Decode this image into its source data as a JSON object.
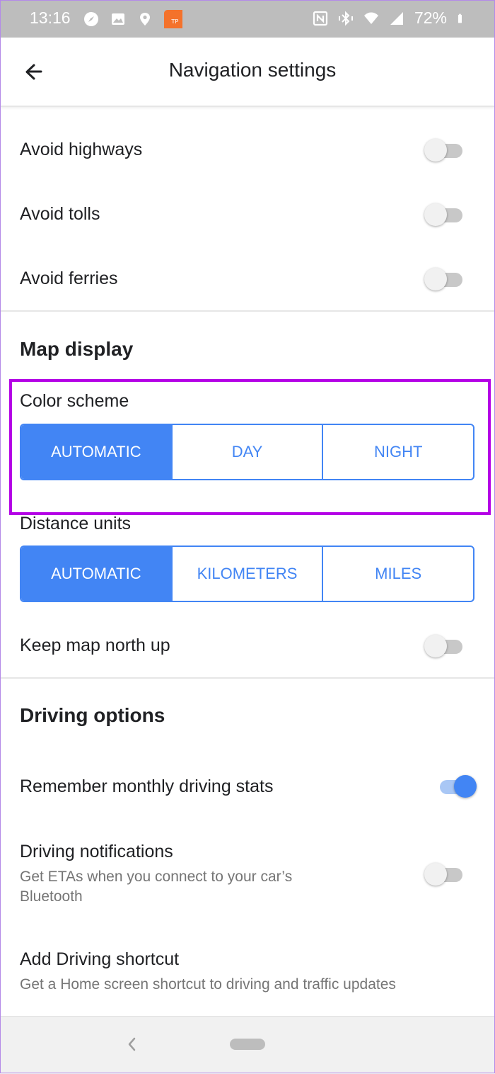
{
  "status_bar": {
    "time": "13:16",
    "battery": "72%",
    "left_icons": [
      "compass-icon",
      "image-icon",
      "location-icon",
      "app-notification-icon"
    ],
    "right_icons": [
      "nfc-icon",
      "vibrate-bluetooth-icon",
      "wifi-icon",
      "cell-signal-icon",
      "battery-icon"
    ]
  },
  "header": {
    "title": "Navigation settings",
    "back_icon": "arrow-left-icon"
  },
  "route_options": [
    {
      "label": "Avoid highways",
      "enabled": false
    },
    {
      "label": "Avoid tolls",
      "enabled": false
    },
    {
      "label": "Avoid ferries",
      "enabled": false
    }
  ],
  "map_display": {
    "title": "Map display",
    "color_scheme": {
      "label": "Color scheme",
      "options": [
        "AUTOMATIC",
        "DAY",
        "NIGHT"
      ],
      "selected": "AUTOMATIC"
    },
    "distance_units": {
      "label": "Distance units",
      "options": [
        "AUTOMATIC",
        "KILOMETERS",
        "MILES"
      ],
      "selected": "AUTOMATIC"
    },
    "keep_north_up": {
      "label": "Keep map north up",
      "enabled": false
    }
  },
  "driving_options": {
    "title": "Driving options",
    "remember_stats": {
      "label": "Remember monthly driving stats",
      "enabled": true
    },
    "notifications": {
      "label": "Driving notifications",
      "subtitle_line1": "Get ETAs when you connect to your car’s",
      "subtitle_line2": "Bluetooth",
      "enabled": false
    },
    "shortcut": {
      "label": "Add Driving shortcut",
      "subtitle": "Get a Home screen shortcut to driving and traffic updates"
    }
  },
  "colors": {
    "accent": "#4285f4",
    "highlight": "#b400e6",
    "status_bar": "#bdbdbd"
  }
}
